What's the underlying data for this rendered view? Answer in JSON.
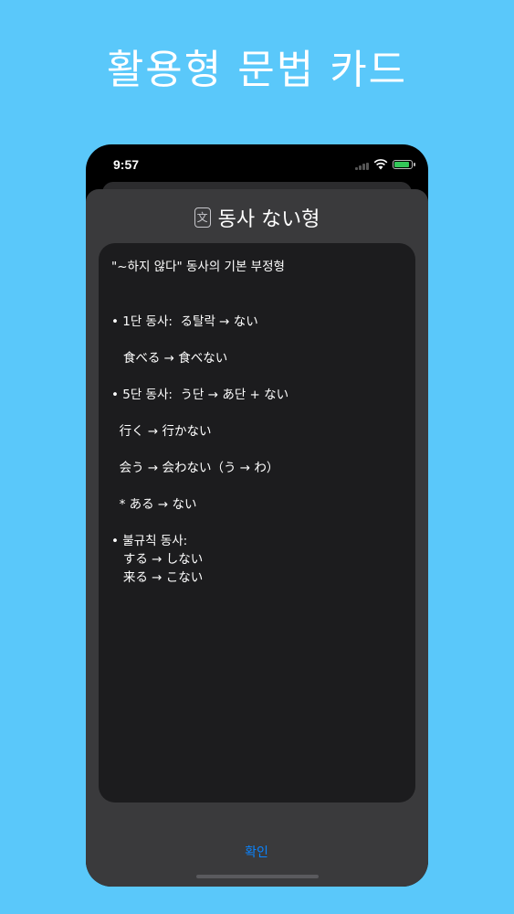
{
  "promo": {
    "title": "활용형 문법 카드"
  },
  "status_bar": {
    "time": "9:57",
    "icons": [
      "cellular-signal-icon",
      "wifi-icon",
      "battery-charging-icon"
    ]
  },
  "sheet": {
    "icon": "translate-icon",
    "icon_glyph": "文",
    "title": "동사 ない형",
    "content_lines": [
      "\"~하지 않다\" 동사의 기본 부정형",
      "",
      "",
      "• 1단 동사:  る탈락 → ない",
      "",
      "   食べる → 食べない",
      "",
      "• 5단 동사:  う단 → あ단 + ない",
      "",
      "  行く → 行かない",
      "",
      "  会う → 会わない（う → わ）",
      "",
      "  * ある → ない",
      "",
      "• 불규칙 동사:",
      "   する → しない",
      "   来る → こない"
    ],
    "confirm_label": "확인"
  },
  "colors": {
    "background": "#5ac8fa",
    "sheet": "#3a3a3c",
    "card": "#1c1c1e",
    "accent": "#0a84ff",
    "battery": "#34c759"
  }
}
